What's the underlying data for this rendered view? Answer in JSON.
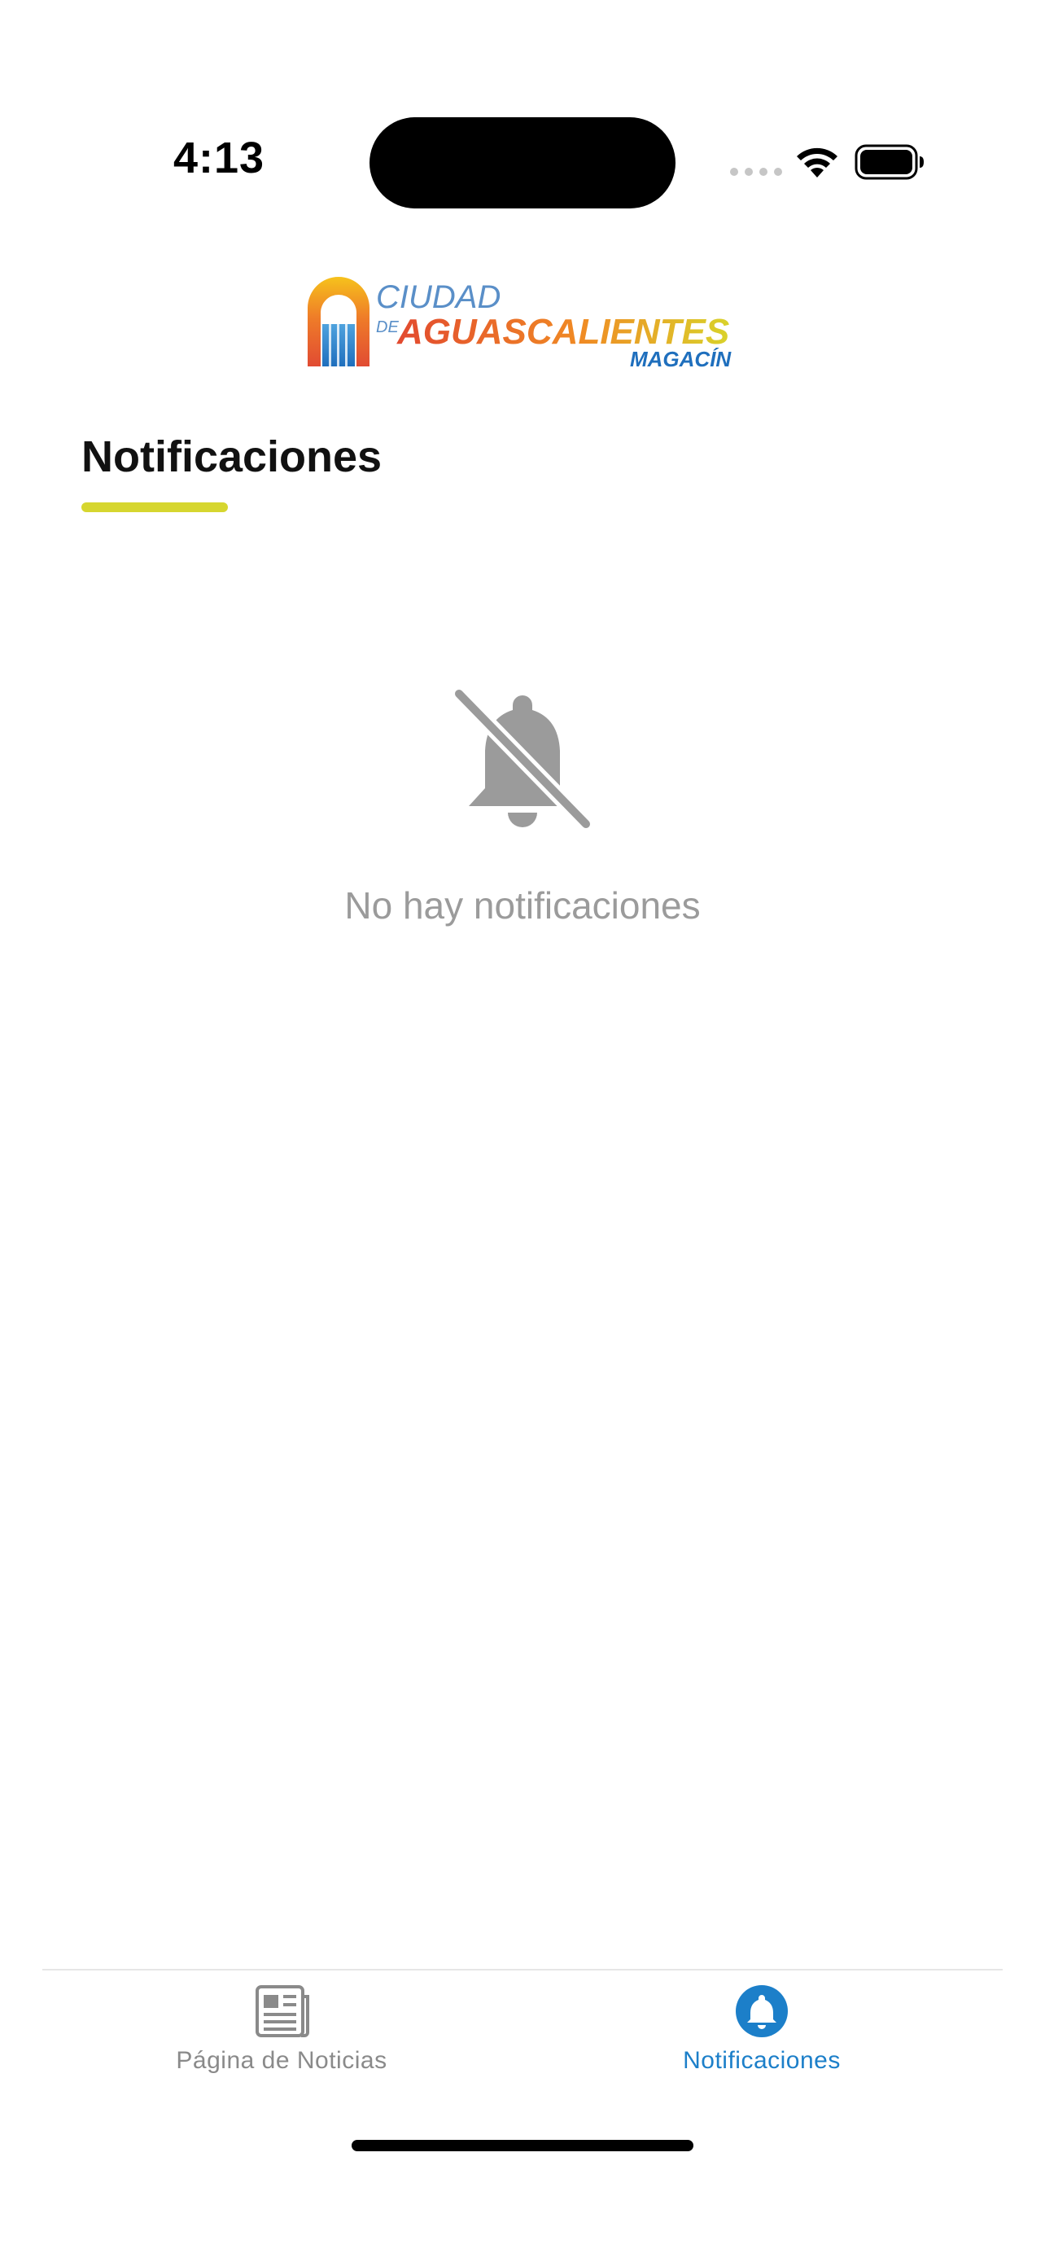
{
  "status_bar": {
    "time": "4:13"
  },
  "logo": {
    "line1": "CIUDAD",
    "line2_prefix": "DE",
    "line2": "AGUASCALIENTES",
    "line3": "MAGACÍN"
  },
  "header": {
    "title": "Notificaciones",
    "accent_color": "#d6d62f"
  },
  "empty_state": {
    "icon": "bell-off-icon",
    "message": "No hay notificaciones"
  },
  "tab_bar": {
    "tabs": [
      {
        "label": "Página de Noticias",
        "icon": "newspaper-icon",
        "active": false
      },
      {
        "label": "Notificaciones",
        "icon": "bell-icon",
        "active": true
      }
    ],
    "active_color": "#1c7fc9",
    "inactive_color": "#8a8a8a"
  }
}
